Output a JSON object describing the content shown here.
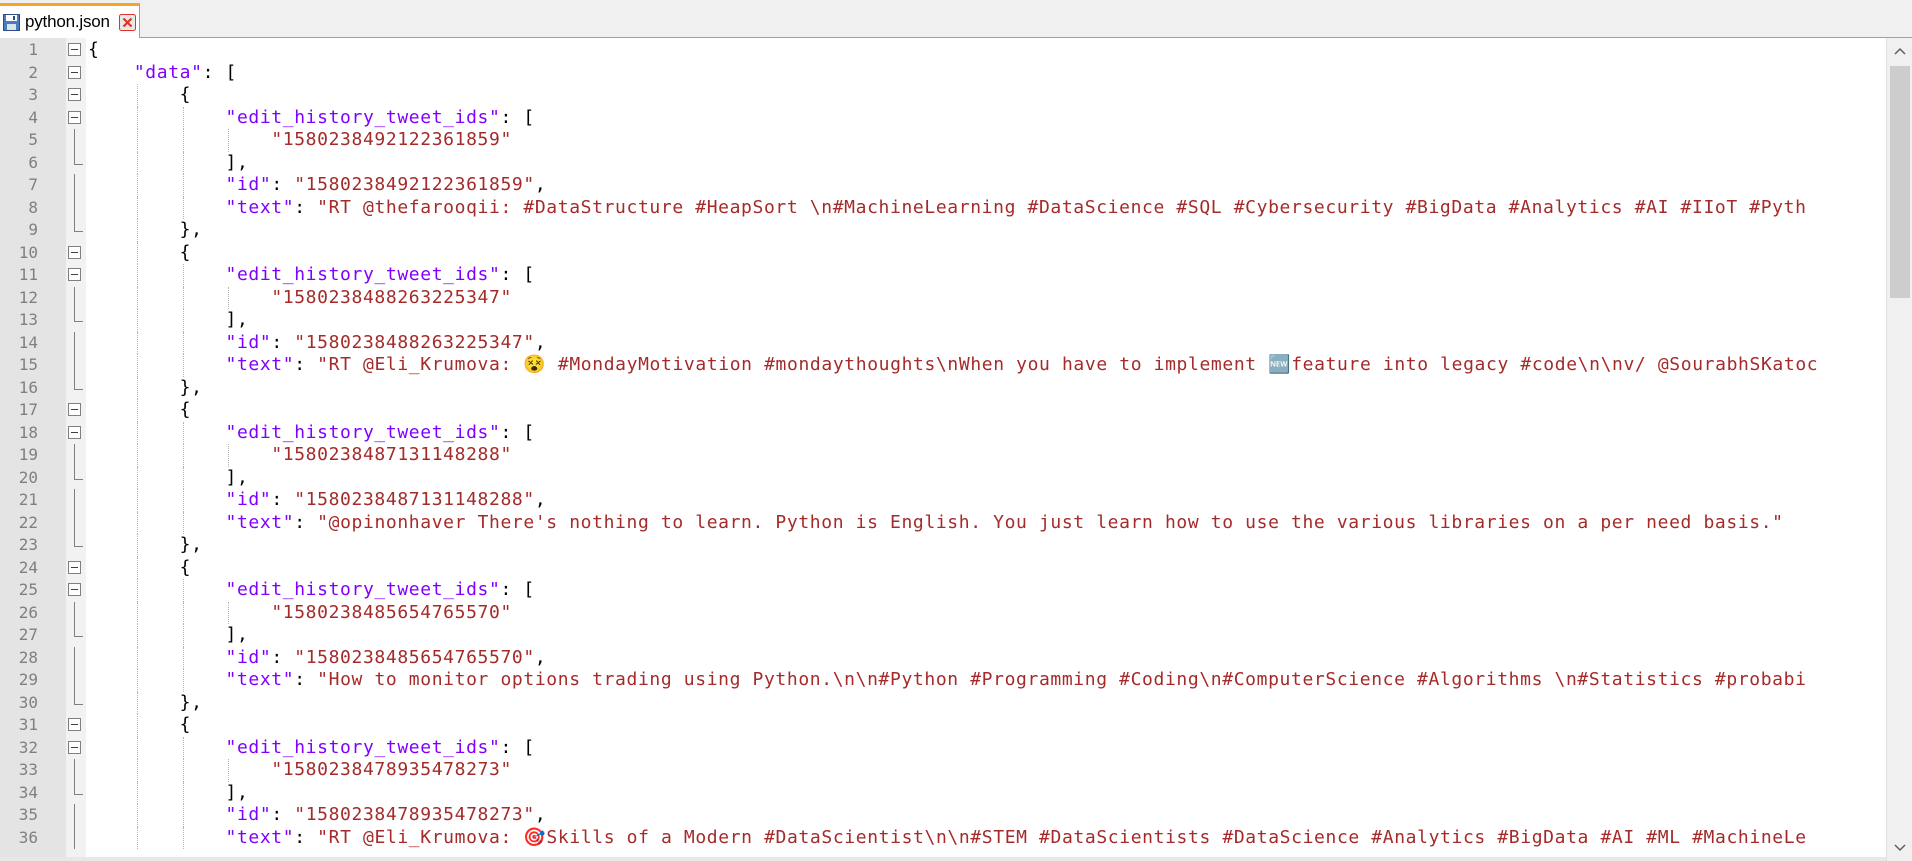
{
  "tab": {
    "filename": "python.json",
    "icon": "save-disk-icon",
    "close_icon": "close-icon",
    "accent": "#f5a623",
    "close_color": "#d9352b"
  },
  "colors": {
    "key": "#8000ff",
    "string": "#a52a2a",
    "punctuation": "#000000",
    "line_number": "#808080",
    "gutter_bg": "#e4e4e4"
  },
  "editor": {
    "lines": [
      {
        "n": "1",
        "fold": "box",
        "segments": [
          {
            "t": "p",
            "v": "{"
          }
        ]
      },
      {
        "n": "2",
        "fold": "box",
        "segments": [
          {
            "t": "p",
            "v": "    "
          },
          {
            "t": "k",
            "v": "\"data\""
          },
          {
            "t": "p",
            "v": ": ["
          }
        ]
      },
      {
        "n": "3",
        "fold": "box",
        "segments": [
          {
            "t": "p",
            "v": "        {"
          }
        ]
      },
      {
        "n": "4",
        "fold": "box",
        "segments": [
          {
            "t": "p",
            "v": "            "
          },
          {
            "t": "k",
            "v": "\"edit_history_tweet_ids\""
          },
          {
            "t": "p",
            "v": ": ["
          }
        ]
      },
      {
        "n": "5",
        "fold": "line",
        "segments": [
          {
            "t": "p",
            "v": "                "
          },
          {
            "t": "s",
            "v": "\"1580238492122361859\""
          }
        ]
      },
      {
        "n": "6",
        "fold": "end",
        "segments": [
          {
            "t": "p",
            "v": "            ],"
          }
        ]
      },
      {
        "n": "7",
        "fold": "line",
        "segments": [
          {
            "t": "p",
            "v": "            "
          },
          {
            "t": "k",
            "v": "\"id\""
          },
          {
            "t": "p",
            "v": ": "
          },
          {
            "t": "s",
            "v": "\"1580238492122361859\""
          },
          {
            "t": "p",
            "v": ","
          }
        ]
      },
      {
        "n": "8",
        "fold": "line",
        "segments": [
          {
            "t": "p",
            "v": "            "
          },
          {
            "t": "k",
            "v": "\"text\""
          },
          {
            "t": "p",
            "v": ": "
          },
          {
            "t": "s",
            "v": "\"RT @thefarooqii: #DataStructure #HeapSort \\n#MachineLearning #DataScience #SQL #Cybersecurity #BigData #Analytics #AI #IIoT #Pyth"
          }
        ]
      },
      {
        "n": "9",
        "fold": "end",
        "segments": [
          {
            "t": "p",
            "v": "        },"
          }
        ]
      },
      {
        "n": "10",
        "fold": "box",
        "segments": [
          {
            "t": "p",
            "v": "        {"
          }
        ]
      },
      {
        "n": "11",
        "fold": "box",
        "segments": [
          {
            "t": "p",
            "v": "            "
          },
          {
            "t": "k",
            "v": "\"edit_history_tweet_ids\""
          },
          {
            "t": "p",
            "v": ": ["
          }
        ]
      },
      {
        "n": "12",
        "fold": "line",
        "segments": [
          {
            "t": "p",
            "v": "                "
          },
          {
            "t": "s",
            "v": "\"1580238488263225347\""
          }
        ]
      },
      {
        "n": "13",
        "fold": "end",
        "segments": [
          {
            "t": "p",
            "v": "            ],"
          }
        ]
      },
      {
        "n": "14",
        "fold": "line",
        "segments": [
          {
            "t": "p",
            "v": "            "
          },
          {
            "t": "k",
            "v": "\"id\""
          },
          {
            "t": "p",
            "v": ": "
          },
          {
            "t": "s",
            "v": "\"1580238488263225347\""
          },
          {
            "t": "p",
            "v": ","
          }
        ]
      },
      {
        "n": "15",
        "fold": "line",
        "segments": [
          {
            "t": "p",
            "v": "            "
          },
          {
            "t": "k",
            "v": "\"text\""
          },
          {
            "t": "p",
            "v": ": "
          },
          {
            "t": "s",
            "v": "\"RT @Eli_Krumova: 😵 #MondayMotivation #mondaythoughts\\nWhen you have to implement 🆕feature into legacy #code\\n\\nv/ @SourabhSKatoc"
          }
        ]
      },
      {
        "n": "16",
        "fold": "end",
        "segments": [
          {
            "t": "p",
            "v": "        },"
          }
        ]
      },
      {
        "n": "17",
        "fold": "box",
        "segments": [
          {
            "t": "p",
            "v": "        {"
          }
        ]
      },
      {
        "n": "18",
        "fold": "box",
        "segments": [
          {
            "t": "p",
            "v": "            "
          },
          {
            "t": "k",
            "v": "\"edit_history_tweet_ids\""
          },
          {
            "t": "p",
            "v": ": ["
          }
        ]
      },
      {
        "n": "19",
        "fold": "line",
        "segments": [
          {
            "t": "p",
            "v": "                "
          },
          {
            "t": "s",
            "v": "\"1580238487131148288\""
          }
        ]
      },
      {
        "n": "20",
        "fold": "end",
        "segments": [
          {
            "t": "p",
            "v": "            ],"
          }
        ]
      },
      {
        "n": "21",
        "fold": "line",
        "segments": [
          {
            "t": "p",
            "v": "            "
          },
          {
            "t": "k",
            "v": "\"id\""
          },
          {
            "t": "p",
            "v": ": "
          },
          {
            "t": "s",
            "v": "\"1580238487131148288\""
          },
          {
            "t": "p",
            "v": ","
          }
        ]
      },
      {
        "n": "22",
        "fold": "line",
        "segments": [
          {
            "t": "p",
            "v": "            "
          },
          {
            "t": "k",
            "v": "\"text\""
          },
          {
            "t": "p",
            "v": ": "
          },
          {
            "t": "s",
            "v": "\"@opinonhaver There's nothing to learn. Python is English. You just learn how to use the various libraries on a per need basis.\""
          }
        ]
      },
      {
        "n": "23",
        "fold": "end",
        "segments": [
          {
            "t": "p",
            "v": "        },"
          }
        ]
      },
      {
        "n": "24",
        "fold": "box",
        "segments": [
          {
            "t": "p",
            "v": "        {"
          }
        ]
      },
      {
        "n": "25",
        "fold": "box",
        "segments": [
          {
            "t": "p",
            "v": "            "
          },
          {
            "t": "k",
            "v": "\"edit_history_tweet_ids\""
          },
          {
            "t": "p",
            "v": ": ["
          }
        ]
      },
      {
        "n": "26",
        "fold": "line",
        "segments": [
          {
            "t": "p",
            "v": "                "
          },
          {
            "t": "s",
            "v": "\"1580238485654765570\""
          }
        ]
      },
      {
        "n": "27",
        "fold": "end",
        "segments": [
          {
            "t": "p",
            "v": "            ],"
          }
        ]
      },
      {
        "n": "28",
        "fold": "line",
        "segments": [
          {
            "t": "p",
            "v": "            "
          },
          {
            "t": "k",
            "v": "\"id\""
          },
          {
            "t": "p",
            "v": ": "
          },
          {
            "t": "s",
            "v": "\"1580238485654765570\""
          },
          {
            "t": "p",
            "v": ","
          }
        ]
      },
      {
        "n": "29",
        "fold": "line",
        "segments": [
          {
            "t": "p",
            "v": "            "
          },
          {
            "t": "k",
            "v": "\"text\""
          },
          {
            "t": "p",
            "v": ": "
          },
          {
            "t": "s",
            "v": "\"How to monitor options trading using Python.\\n\\n#Python #Programming #Coding\\n#ComputerScience #Algorithms \\n#Statistics #probabi"
          }
        ]
      },
      {
        "n": "30",
        "fold": "end",
        "segments": [
          {
            "t": "p",
            "v": "        },"
          }
        ]
      },
      {
        "n": "31",
        "fold": "box",
        "segments": [
          {
            "t": "p",
            "v": "        {"
          }
        ]
      },
      {
        "n": "32",
        "fold": "box",
        "segments": [
          {
            "t": "p",
            "v": "            "
          },
          {
            "t": "k",
            "v": "\"edit_history_tweet_ids\""
          },
          {
            "t": "p",
            "v": ": ["
          }
        ]
      },
      {
        "n": "33",
        "fold": "line",
        "segments": [
          {
            "t": "p",
            "v": "                "
          },
          {
            "t": "s",
            "v": "\"1580238478935478273\""
          }
        ]
      },
      {
        "n": "34",
        "fold": "end",
        "segments": [
          {
            "t": "p",
            "v": "            ],"
          }
        ]
      },
      {
        "n": "35",
        "fold": "line",
        "segments": [
          {
            "t": "p",
            "v": "            "
          },
          {
            "t": "k",
            "v": "\"id\""
          },
          {
            "t": "p",
            "v": ": "
          },
          {
            "t": "s",
            "v": "\"1580238478935478273\""
          },
          {
            "t": "p",
            "v": ","
          }
        ]
      },
      {
        "n": "36",
        "fold": "line",
        "segments": [
          {
            "t": "p",
            "v": "            "
          },
          {
            "t": "k",
            "v": "\"text\""
          },
          {
            "t": "p",
            "v": ": "
          },
          {
            "t": "s",
            "v": "\"RT @Eli_Krumova: 🎯Skills of a Modern #DataScientist\\n\\n#STEM #DataScientists #DataScience #Analytics #BigData #AI #ML #MachineLe"
          }
        ]
      }
    ]
  },
  "scrollbar": {
    "up_icon": "scroll-up-arrow-icon",
    "down_icon": "scroll-down-arrow-icon"
  }
}
